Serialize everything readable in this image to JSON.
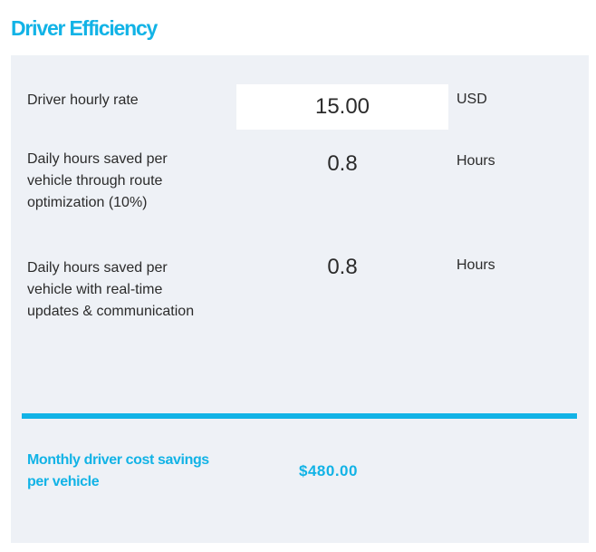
{
  "section": {
    "title": "Driver Efficiency"
  },
  "rows": [
    {
      "label": "Driver hourly rate",
      "value": "15.00",
      "unit": "USD"
    },
    {
      "label": "Daily hours saved per vehicle through route optimization (10%)",
      "value": "0.8",
      "unit": "Hours"
    },
    {
      "label": "Daily hours saved per vehicle with real-time updates & communication",
      "value": "0.8",
      "unit": "Hours"
    }
  ],
  "total": {
    "label": "Monthly driver cost savings per vehicle",
    "value": "$480.00"
  },
  "colors": {
    "accent": "#12b3e6",
    "panel_bg": "#eef1f6",
    "text": "#2b2b2b"
  }
}
